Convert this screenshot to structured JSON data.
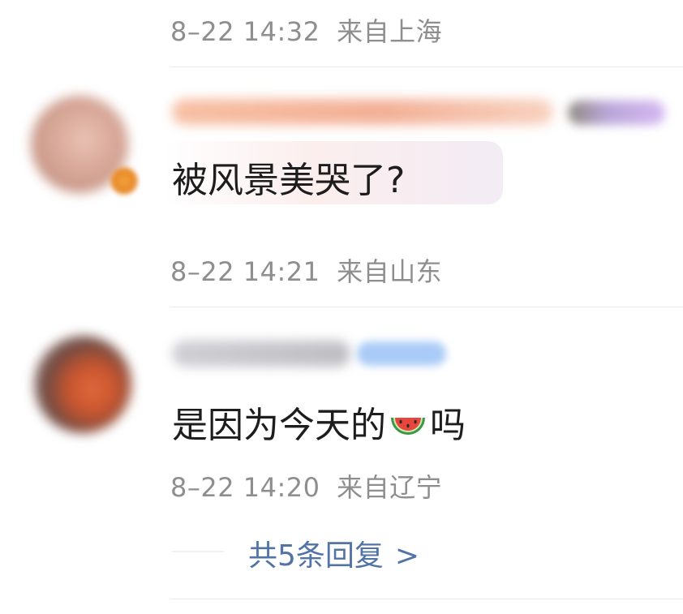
{
  "comments": [
    {
      "id": "prev",
      "date": "8–22",
      "time": "14:32",
      "location": "来自上海"
    },
    {
      "id": "c1",
      "text": "被风景美哭了?",
      "date": "8–22",
      "time": "14:21",
      "location": "来自山东"
    },
    {
      "id": "c2",
      "text_before": "是因为今天的",
      "emoji": "watermelon",
      "text_after": "吗",
      "date": "8–22",
      "time": "14:20",
      "location": "来自辽宁"
    }
  ],
  "replies": {
    "label": "共5条回复",
    "chevron": ">"
  },
  "colors": {
    "meta_text": "#8e8e8e",
    "body_text": "#1d1d1d",
    "link": "#5173a6",
    "divider": "#e8e8e8"
  },
  "icons": {
    "emoji": "watermelon-icon",
    "chevron": "chevron-right-icon"
  }
}
